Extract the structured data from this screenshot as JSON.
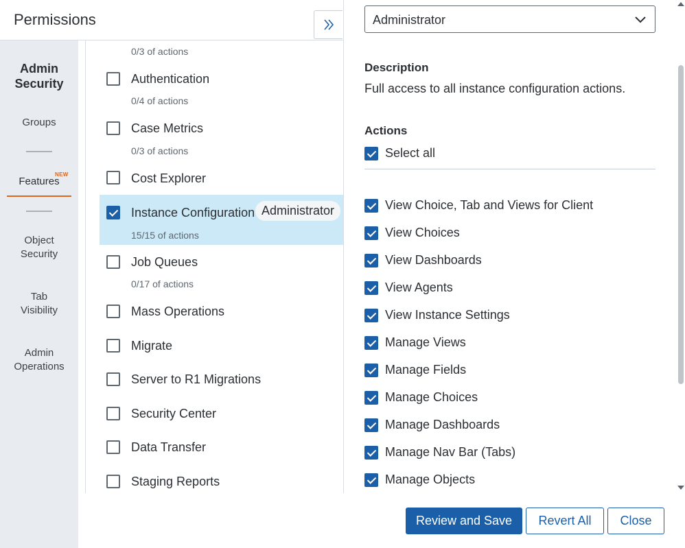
{
  "header": {
    "title": "Permissions"
  },
  "leftnav": {
    "heading_line1": "Admin",
    "heading_line2": "Security",
    "items": [
      {
        "label": "Groups"
      },
      {
        "label": "Features",
        "badge": "NEW",
        "active": true
      },
      {
        "label_line1": "Object",
        "label_line2": "Security"
      },
      {
        "label_line1": "Tab",
        "label_line2": "Visibility"
      },
      {
        "label_line1": "Admin",
        "label_line2": "Operations"
      }
    ]
  },
  "features": {
    "top_partial_sub": "0/3 of actions",
    "rows": [
      {
        "name": "Authentication",
        "sub": "0/4 of actions",
        "checked": false
      },
      {
        "name": "Case Metrics",
        "sub": "0/3 of actions",
        "checked": false
      },
      {
        "name": "Cost Explorer",
        "sub": "",
        "checked": false
      },
      {
        "name": "Instance Configuration",
        "sub": "15/15 of actions",
        "checked": true,
        "role": "Administrator"
      },
      {
        "name": "Job Queues",
        "sub": "0/17 of actions",
        "checked": false
      },
      {
        "name": "Mass Operations",
        "sub": "",
        "checked": false
      },
      {
        "name": "Migrate",
        "sub": "",
        "checked": false
      },
      {
        "name": "Server to R1 Migrations",
        "sub": "",
        "checked": false
      },
      {
        "name": "Security Center",
        "sub": "",
        "checked": false
      },
      {
        "name": "Data Transfer",
        "sub": "",
        "checked": false
      },
      {
        "name": "Staging Reports",
        "sub": "",
        "checked": false
      }
    ]
  },
  "detail": {
    "role_select_value": "Administrator",
    "description_heading": "Description",
    "description_text": "Full access to all instance configuration actions.",
    "actions_heading": "Actions",
    "select_all_label": "Select all",
    "actions": [
      "View Choice, Tab and Views for Client",
      "View Choices",
      "View Dashboards",
      "View Agents",
      "View Instance Settings",
      "Manage Views",
      "Manage Fields",
      "Manage Choices",
      "Manage Dashboards",
      "Manage Nav Bar (Tabs)",
      "Manage Objects"
    ]
  },
  "footer": {
    "review_save_label": "Review and Save",
    "revert_all_label": "Revert All",
    "close_label": "Close"
  },
  "colors": {
    "primary": "#1a5fa8",
    "accent_orange": "#e0651c",
    "selected_row": "#cce9f7",
    "nav_bg": "#e8ecf1"
  }
}
